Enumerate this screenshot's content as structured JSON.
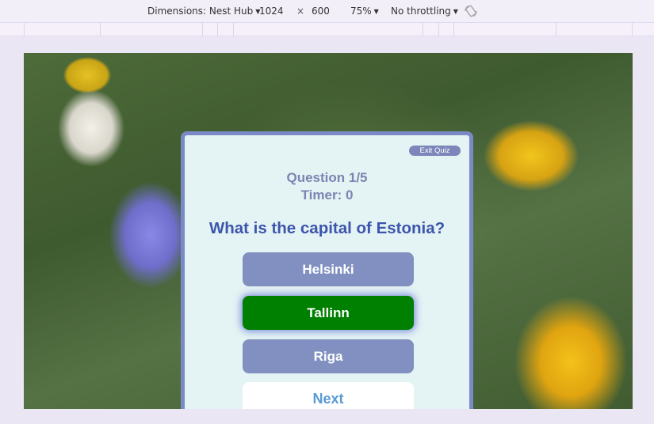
{
  "devtools": {
    "dimensions_label": "Dimensions: Nest Hub",
    "width": "1024",
    "times": "×",
    "height": "600",
    "zoom": "75%",
    "throttling": "No throttling",
    "caret": "▼",
    "rotate_icon": "rotate-icon"
  },
  "quiz": {
    "exit_label": "Exit Quiz",
    "question_counter": "Question 1/5",
    "timer": "Timer: 0",
    "question": "What is the capital of Estonia?",
    "answers": [
      "Helsinki",
      "Tallinn",
      "Riga"
    ],
    "selected_answer": "Tallinn",
    "next_label": "Next",
    "colors": {
      "answer_default": "#8190c0",
      "answer_correct": "#008000",
      "card_border": "#7a8ac6",
      "card_bg": "#e4f3f3",
      "question_text": "#3c55ad"
    }
  }
}
